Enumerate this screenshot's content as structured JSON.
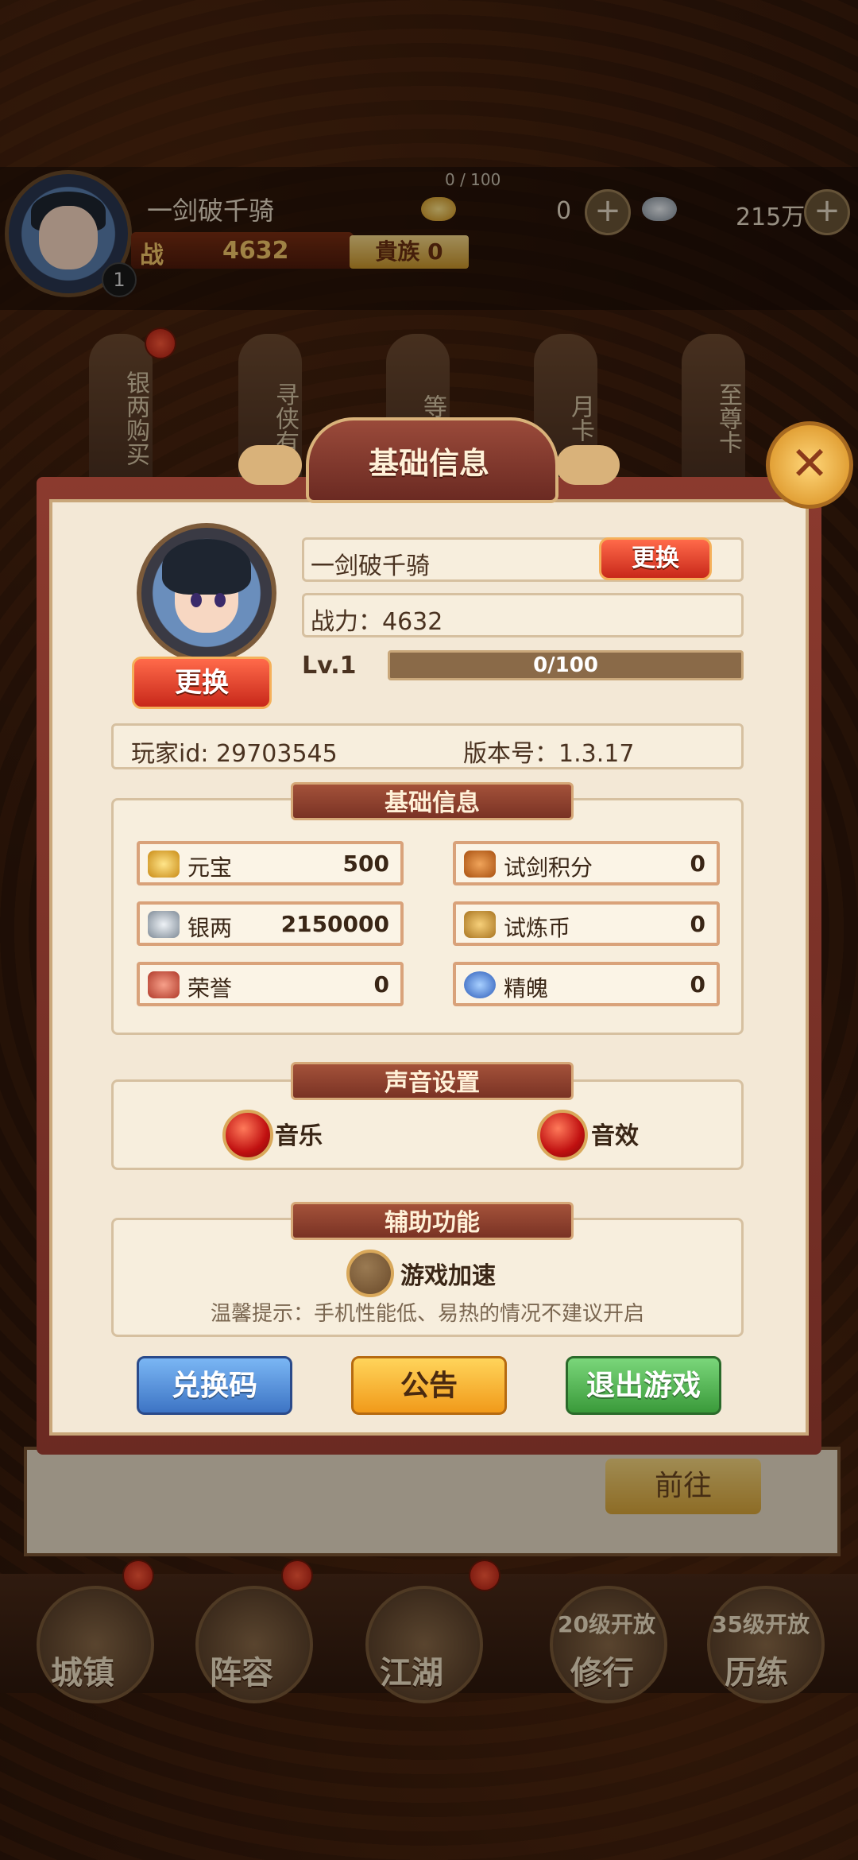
{
  "hud": {
    "player_name": "一剑破千骑",
    "level_badge": "1",
    "exp": "0 / 100",
    "gold": "0",
    "silver": "215万",
    "power_icon": "战",
    "power": "4632",
    "noble": "貴族 0"
  },
  "plaques": [
    "银两购买",
    "寻侠有",
    "等级",
    "月卡",
    "至尊卡"
  ],
  "bottom_nav": {
    "town": "城镇",
    "lineup": "阵容",
    "jianghu": "江湖",
    "practice_lock": "20级开放",
    "practice": "修行",
    "trial_lock": "35级开放",
    "trial": "历练"
  },
  "under_panel": {
    "goto": "前往"
  },
  "modal": {
    "title": "基础信息",
    "close_icon": "close-icon",
    "avatar_change": "更换",
    "name": "一剑破千骑",
    "name_change": "更换",
    "power_text": "战力：4632",
    "level": "Lv.1",
    "exp_text": "0/100",
    "exp_fraction": 0,
    "player_id": "玩家id: 29703545",
    "version": "版本号：1.3.17",
    "resources_title": "基础信息",
    "resources": [
      {
        "name": "元宝",
        "value": "500",
        "icon": "gold-ingot-icon",
        "color": "#e8b22a"
      },
      {
        "name": "试剑积分",
        "value": "0",
        "icon": "sword-score-icon",
        "color": "#c96a1a"
      },
      {
        "name": "银两",
        "value": "2150000",
        "icon": "silver-ingot-icon",
        "color": "#9aa4ae"
      },
      {
        "name": "试炼币",
        "value": "0",
        "icon": "trial-coin-icon",
        "color": "#c9952a"
      },
      {
        "name": "荣誉",
        "value": "0",
        "icon": "honor-icon",
        "color": "#c85a4a"
      },
      {
        "name": "精魄",
        "value": "0",
        "icon": "spirit-icon",
        "color": "#3a7adf"
      }
    ],
    "sound_title": "声音设置",
    "music": "音乐",
    "sfx": "音效",
    "aux_title": "辅助功能",
    "speedup": "游戏加速",
    "tip": "温馨提示：手机性能低、易热的情况不建议开启",
    "redeem": "兑换码",
    "notice": "公告",
    "exit": "退出游戏"
  }
}
